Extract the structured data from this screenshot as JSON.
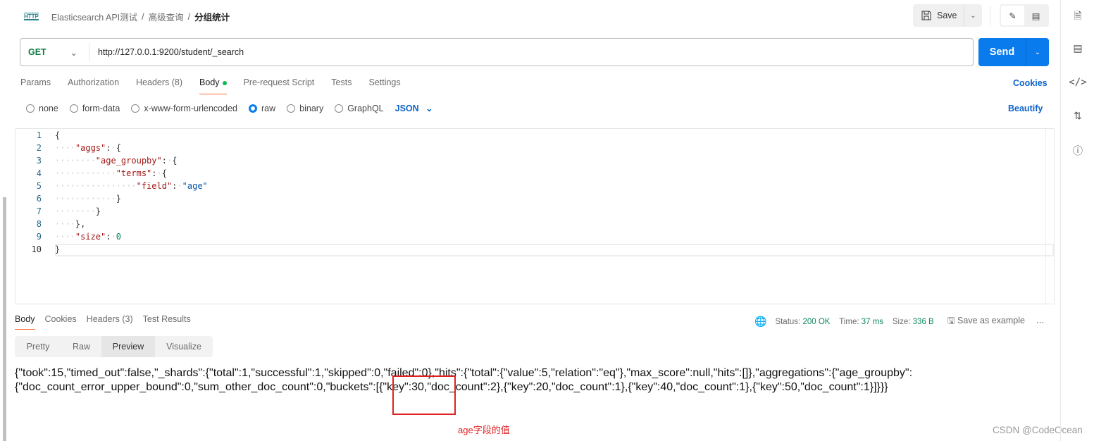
{
  "breadcrumb": {
    "icon": "http-icon",
    "collection": "Elasticsearch API测试",
    "folder": "高级查询",
    "request": "分组统计",
    "sep": "/"
  },
  "toolbar": {
    "save_label": "Save"
  },
  "request": {
    "method": "GET",
    "url": "http://127.0.0.1:9200/student/_search",
    "send_label": "Send"
  },
  "tabs": [
    {
      "label": "Params"
    },
    {
      "label": "Authorization"
    },
    {
      "label": "Headers (8)"
    },
    {
      "label": "Body",
      "active": true
    },
    {
      "label": "Pre-request Script"
    },
    {
      "label": "Tests"
    },
    {
      "label": "Settings"
    }
  ],
  "cookies_label": "Cookies",
  "body_types": [
    {
      "label": "none"
    },
    {
      "label": "form-data"
    },
    {
      "label": "x-www-form-urlencoded"
    },
    {
      "label": "raw",
      "selected": true
    },
    {
      "label": "binary"
    },
    {
      "label": "GraphQL"
    }
  ],
  "format": "JSON",
  "beautify_label": "Beautify",
  "code_lines": [
    {
      "num": "1",
      "indent": 0,
      "tokens": [
        [
          "{",
          "p"
        ]
      ]
    },
    {
      "num": "2",
      "indent": 1,
      "tokens": [
        [
          "\"aggs\"",
          "k"
        ],
        [
          ":",
          "p"
        ],
        [
          " ",
          "w"
        ],
        [
          "{",
          "p"
        ]
      ]
    },
    {
      "num": "3",
      "indent": 2,
      "tokens": [
        [
          "\"age_groupby\"",
          "k"
        ],
        [
          ":",
          "p"
        ],
        [
          " ",
          "w"
        ],
        [
          "{",
          "p"
        ]
      ]
    },
    {
      "num": "4",
      "indent": 3,
      "tokens": [
        [
          "\"terms\"",
          "k"
        ],
        [
          ":",
          "p"
        ],
        [
          " ",
          "w"
        ],
        [
          "{",
          "p"
        ]
      ]
    },
    {
      "num": "5",
      "indent": 4,
      "tokens": [
        [
          "\"field\"",
          "k"
        ],
        [
          ":",
          "p"
        ],
        [
          " ",
          "w"
        ],
        [
          "\"age\"",
          "s"
        ]
      ]
    },
    {
      "num": "6",
      "indent": 3,
      "tokens": [
        [
          "}",
          "p"
        ]
      ]
    },
    {
      "num": "7",
      "indent": 2,
      "tokens": [
        [
          "}",
          "p"
        ]
      ]
    },
    {
      "num": "8",
      "indent": 1,
      "tokens": [
        [
          "},",
          "p"
        ]
      ]
    },
    {
      "num": "9",
      "indent": 1,
      "tokens": [
        [
          "\"size\"",
          "k"
        ],
        [
          ":",
          "p"
        ],
        [
          " ",
          "w"
        ],
        [
          "0",
          "n"
        ]
      ]
    },
    {
      "num": "10",
      "indent": 0,
      "tokens": [
        [
          "}",
          "p"
        ]
      ]
    }
  ],
  "response": {
    "tabs": [
      {
        "label": "Body",
        "active": true
      },
      {
        "label": "Cookies"
      },
      {
        "label": "Headers (3)"
      },
      {
        "label": "Test Results"
      }
    ],
    "status_label": "Status:",
    "status": "200 OK",
    "time_label": "Time:",
    "time": "37 ms",
    "size_label": "Size:",
    "size": "336 B",
    "save_example": "Save as example",
    "view_tabs": [
      {
        "label": "Pretty"
      },
      {
        "label": "Raw"
      },
      {
        "label": "Preview",
        "active": true
      },
      {
        "label": "Visualize"
      }
    ],
    "body_line1": "{\"took\":15,\"timed_out\":false,\"_shards\":{\"total\":1,\"successful\":1,\"skipped\":0,\"failed\":0},\"hits\":{\"total\":{\"value\":5,\"relation\":\"eq\"},\"max_score\":null,\"hits\":[]},\"aggregations\":{\"age_groupby\":",
    "body_line2": "{\"doc_count_error_upper_bound\":0,\"sum_other_doc_count\":0,\"buckets\":[{\"key\":30,\"doc_count\":2},{\"key\":20,\"doc_count\":1},{\"key\":40,\"doc_count\":1},{\"key\":50,\"doc_count\":1}]}}}"
  },
  "annotation": {
    "note": "age字段的值",
    "color": "#e02020"
  },
  "watermark": "CSDN @CodeOcean",
  "colors": {
    "accent": "#097bed",
    "tab_underline": "#ff6c37",
    "status_green": "#0b8a5a",
    "method_get": "#0b7a3e"
  }
}
